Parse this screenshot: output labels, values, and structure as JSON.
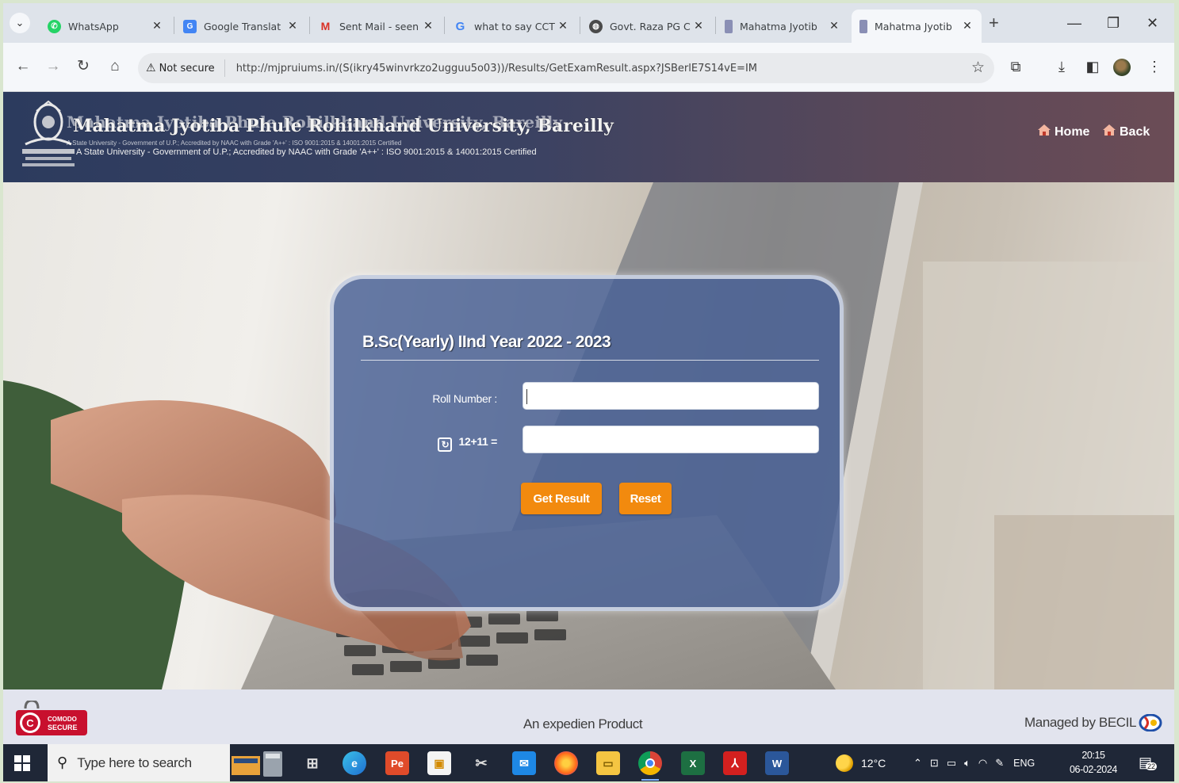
{
  "browser": {
    "tabs": [
      {
        "title": "WhatsApp",
        "icon": "whatsapp-icon",
        "color": "#25d366",
        "glyph": ""
      },
      {
        "title": "Google Translat",
        "icon": "google-translate-icon",
        "color": "#4285f4",
        "glyph": "G"
      },
      {
        "title": "Sent Mail - seen",
        "icon": "gmail-icon",
        "color": "#ffffff",
        "glyph": "M"
      },
      {
        "title": "what to say CCT",
        "icon": "google-icon",
        "color": "#ffffff",
        "glyph": "G"
      },
      {
        "title": "Govt. Raza PG C",
        "icon": "globe-icon",
        "color": "#555555",
        "glyph": ""
      },
      {
        "title": "Mahatma Jyotib",
        "icon": "university-favicon-icon",
        "color": "#8a8fb5",
        "glyph": ""
      },
      {
        "title": "Mahatma Jyotib",
        "icon": "university-favicon-icon",
        "color": "#8a8fb5",
        "glyph": ""
      }
    ],
    "active_tab_index": 6,
    "security_chip": "Not secure",
    "url": "http://mjpruiums.in/(S(ikry45winvrkzo2ugguu5o03))/Results/GetExamResult.aspx?JSBerlE7S14vE=IM"
  },
  "site": {
    "university_name": "Mahatma Jyotiba Phule Rohilkhand University, Bareilly",
    "tagline": "A State University - Government of U.P.; Accredited by NAAC with Grade 'A++' : ISO 9001:2015 & 14001:2015 Certified",
    "nav": {
      "home": "Home",
      "back": "Back"
    }
  },
  "form": {
    "title": "B.Sc(Yearly) IInd Year 2022 - 2023",
    "roll_label": "Roll Number :",
    "roll_value": "",
    "captcha_question": "12+11 =",
    "captcha_value": "",
    "submit_label": "Get Result",
    "reset_label": "Reset"
  },
  "footer": {
    "badge_line1": "COMODO",
    "badge_line2": "SECURE",
    "center_text": "An expedien Product",
    "right_text": "Managed by BECIL"
  },
  "taskbar": {
    "search_placeholder": "Type here to search",
    "weather": "12°C",
    "language": "ENG",
    "time": "20:15",
    "date": "06-02-2024",
    "notification_count": "22"
  },
  "colors": {
    "header_start": "#2c3b5e",
    "header_end": "#6b4c56",
    "card": "#4860a0",
    "button": "#f28a0e"
  }
}
